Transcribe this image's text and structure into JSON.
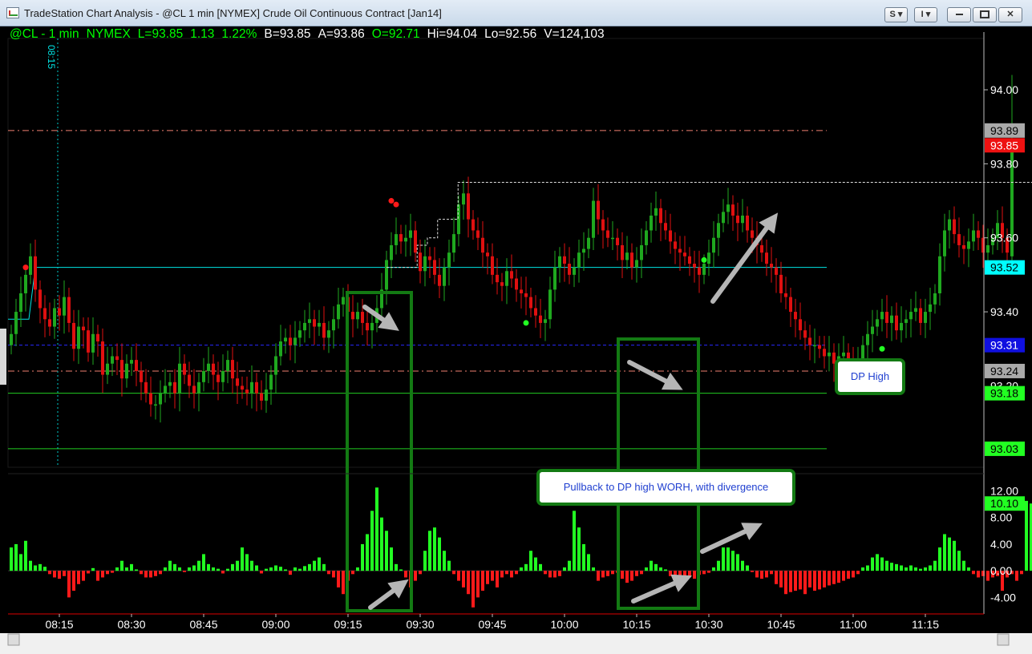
{
  "window": {
    "title": "TradeStation Chart Analysis - @CL 1 min [NYMEX] Crude Oil Continuous Contract [Jan14]",
    "btn_s": "S ▾",
    "btn_i": "I ▾"
  },
  "info": {
    "symbol": "@CL - 1 min",
    "exchange": "NYMEX",
    "last": "L=93.85",
    "change": "1.13",
    "pct": "1.22%",
    "bid": "B=93.85",
    "ask": "A=93.86",
    "open": "O=92.71",
    "high": "Hi=94.04",
    "low": "Lo=92.56",
    "volume": "V=124,103"
  },
  "cursor_time_label": "08:15",
  "callouts": {
    "dp_high": "DP High",
    "pullback": "Pullback to DP high WORH, with divergence"
  },
  "colors": {
    "up": "#1fa81f",
    "down": "#e01010",
    "osc_up": "#22ff22",
    "osc_down": "#ff1a1a",
    "box": "#137a13"
  },
  "chart_data": [
    {
      "type": "candlestick",
      "x_ticks": [
        "08:15",
        "08:30",
        "08:45",
        "09:00",
        "09:15",
        "09:30",
        "09:45",
        "10:00",
        "10:15",
        "10:30",
        "10:45",
        "11:00",
        "11:15"
      ],
      "y_ticks": [
        93.4,
        93.6,
        93.8,
        94.0
      ],
      "y_tick_labels": [
        "93.40",
        "93.60",
        "93.80",
        "94.00"
      ],
      "ylim": [
        92.98,
        94.13
      ],
      "x_start": "08:05",
      "tick_labels_extra": [
        "93.20"
      ],
      "price_tags": [
        {
          "label": "93.89",
          "value": 93.89,
          "bg": "#a9a9a9",
          "fg": "#000"
        },
        {
          "label": "93.85",
          "value": 93.85,
          "bg": "#ee1111",
          "fg": "#fff"
        },
        {
          "label": "93.52",
          "value": 93.52,
          "bg": "#00ffff",
          "fg": "#000"
        },
        {
          "label": "93.31",
          "value": 93.31,
          "bg": "#1010e0",
          "fg": "#fff"
        },
        {
          "label": "93.24",
          "value": 93.24,
          "bg": "#a9a9a9",
          "fg": "#000"
        },
        {
          "label": "93.18",
          "value": 93.18,
          "bg": "#22ff22",
          "fg": "#000"
        },
        {
          "label": "93.03",
          "value": 93.03,
          "bg": "#22ff22",
          "fg": "#000"
        }
      ],
      "levels": [
        {
          "value": 93.89,
          "color": "#f08070",
          "style": "dashdot"
        },
        {
          "value": 93.52,
          "color": "#00e5e5",
          "style": "solid",
          "from": "08:10"
        },
        {
          "value": 93.31,
          "color": "#2828ff",
          "style": "dashed"
        },
        {
          "value": 93.24,
          "color": "#f08070",
          "style": "dashdot"
        },
        {
          "value": 93.18,
          "color": "#22cc22",
          "style": "solid"
        },
        {
          "value": 93.03,
          "color": "#22cc22",
          "style": "solid"
        }
      ],
      "closes": [
        93.34,
        93.4,
        93.45,
        93.5,
        93.55,
        93.46,
        93.41,
        93.38,
        93.36,
        93.41,
        93.39,
        93.44,
        93.37,
        93.3,
        93.36,
        93.35,
        93.29,
        93.34,
        93.32,
        93.23,
        93.26,
        93.28,
        93.27,
        93.22,
        93.26,
        93.27,
        93.24,
        93.21,
        93.18,
        93.15,
        93.15,
        93.18,
        93.2,
        93.21,
        93.18,
        93.26,
        93.23,
        93.2,
        93.18,
        93.21,
        93.24,
        93.26,
        93.23,
        93.21,
        93.24,
        93.27,
        93.22,
        93.2,
        93.19,
        93.18,
        93.21,
        93.18,
        93.16,
        93.19,
        93.23,
        93.28,
        93.32,
        93.33,
        93.31,
        93.33,
        93.35,
        93.37,
        93.38,
        93.36,
        93.37,
        93.33,
        93.35,
        93.38,
        93.42,
        93.44,
        93.4,
        93.38,
        93.4,
        93.37,
        93.35,
        93.37,
        93.41,
        93.46,
        93.54,
        93.58,
        93.61,
        93.59,
        93.6,
        93.62,
        93.56,
        93.51,
        93.55,
        93.54,
        93.5,
        93.47,
        93.52,
        93.56,
        93.61,
        93.69,
        93.72,
        93.65,
        93.62,
        93.6,
        93.56,
        93.55,
        93.5,
        93.48,
        93.47,
        93.51,
        93.49,
        93.46,
        93.45,
        93.44,
        93.41,
        93.39,
        93.37,
        93.38,
        93.46,
        93.52,
        93.55,
        93.53,
        93.5,
        93.52,
        93.56,
        93.57,
        93.6,
        93.7,
        93.65,
        93.62,
        93.6,
        93.6,
        93.58,
        93.54,
        93.56,
        93.52,
        93.54,
        93.58,
        93.62,
        93.66,
        93.68,
        93.64,
        93.62,
        93.59,
        93.57,
        93.56,
        93.55,
        93.53,
        93.52,
        93.5,
        93.53,
        93.56,
        93.6,
        93.64,
        93.67,
        93.69,
        93.66,
        93.64,
        93.66,
        93.62,
        93.6,
        93.58,
        93.56,
        93.53,
        93.52,
        93.5,
        93.45,
        93.44,
        93.4,
        93.38,
        93.35,
        93.33,
        93.31,
        93.31,
        93.3,
        93.28,
        93.29,
        93.26,
        93.28,
        93.29,
        93.27,
        93.25,
        93.26,
        93.31,
        93.34,
        93.36,
        93.38,
        93.4,
        93.37,
        93.39,
        93.35,
        93.37,
        93.38,
        93.4,
        93.41,
        93.37,
        93.4,
        93.42,
        93.45,
        93.55,
        93.62,
        93.65,
        93.61,
        93.58,
        93.57,
        93.59,
        93.62,
        93.6,
        93.56,
        93.58,
        93.6,
        93.64,
        93.6,
        93.56,
        93.85
      ],
      "special_bar": {
        "open": 93.55,
        "high": 94.04,
        "low": 93.53,
        "close": 93.85
      },
      "dashed_step_series": [
        {
          "values": [
            93.52,
            93.52,
            93.52,
            93.58,
            93.6,
            93.65,
            93.65,
            93.75
          ],
          "from_bar": 78,
          "to_bar": 95
        },
        {
          "value": 93.75,
          "from_bar": 95,
          "to_bar": 216
        }
      ],
      "green_dots": [
        {
          "bar": 107,
          "value": 93.37
        },
        {
          "bar": 144,
          "value": 93.54
        },
        {
          "bar": 181,
          "value": 93.3
        }
      ],
      "red_dots": [
        {
          "bar": 3,
          "value": 93.52
        },
        {
          "bar": 79,
          "value": 93.7
        },
        {
          "bar": 80,
          "value": 93.69
        },
        {
          "bar": 216,
          "value": 93.94
        },
        {
          "bar": 217,
          "value": 94.07
        }
      ]
    },
    {
      "type": "bar",
      "name": "oscillator",
      "y_ticks": [
        -4,
        0,
        4,
        8,
        12
      ],
      "y_tick_labels": [
        "-4.00",
        "0.00",
        "4.00",
        "8.00",
        "12.00"
      ],
      "ylim": [
        -6.0,
        13.5
      ],
      "last_value_label": "10.10",
      "values": [
        3.5,
        4.0,
        2.5,
        4.5,
        1.5,
        0.8,
        1.0,
        0.6,
        -0.5,
        -1.0,
        -1.2,
        -0.8,
        -4.0,
        -3.0,
        -2.0,
        -1.5,
        -0.4,
        0.4,
        -1.5,
        -1.0,
        -0.5,
        -0.3,
        0.5,
        1.5,
        0.5,
        1.0,
        0.2,
        -0.5,
        -1.0,
        -1.0,
        -0.8,
        -0.5,
        0.5,
        1.5,
        1.0,
        0.5,
        -0.2,
        0.5,
        0.8,
        1.5,
        2.5,
        1.0,
        0.5,
        0.3,
        -0.4,
        0.3,
        1.0,
        1.5,
        3.5,
        2.5,
        1.5,
        0.8,
        -0.4,
        0.3,
        0.5,
        0.8,
        0.6,
        0.2,
        -0.6,
        0.5,
        0.3,
        0.7,
        1.0,
        1.5,
        2.0,
        1.0,
        -0.5,
        -1.0,
        -2.5,
        -3.5,
        -1.5,
        -0.5,
        0.5,
        4.0,
        5.5,
        9.0,
        12.5,
        8.0,
        6.0,
        3.5,
        1.0,
        0.2,
        -1.0,
        -2.5,
        -1.5,
        -0.5,
        3.0,
        6.0,
        6.5,
        5.0,
        3.0,
        1.5,
        -0.5,
        -1.5,
        -2.5,
        -3.5,
        -5.5,
        -4.0,
        -3.0,
        -2.0,
        -1.5,
        -2.5,
        -1.0,
        -0.5,
        -1.0,
        -0.5,
        0.5,
        1.0,
        3.0,
        2.0,
        1.0,
        -0.5,
        -1.0,
        -1.0,
        -0.8,
        0.5,
        1.5,
        9.0,
        6.5,
        4.0,
        2.5,
        0.5,
        -1.5,
        -1.0,
        -0.8,
        -0.5,
        -0.3,
        -1.2,
        -1.8,
        -1.5,
        -0.8,
        -0.5,
        0.5,
        1.5,
        1.0,
        0.5,
        0.2,
        -0.8,
        -1.0,
        -1.2,
        -1.5,
        -1.0,
        -1.2,
        -0.6,
        -0.5,
        -0.3,
        0.5,
        1.5,
        3.5,
        3.5,
        3.0,
        2.5,
        1.5,
        0.8,
        -0.2,
        -1.0,
        -1.2,
        -1.0,
        -0.5,
        -2.0,
        -2.5,
        -3.5,
        -3.2,
        -3.0,
        -2.8,
        -3.5,
        -2.5,
        -3.0,
        -2.8,
        -2.5,
        -2.2,
        -2.0,
        -1.8,
        -1.5,
        -1.2,
        -1.0,
        -0.5,
        0.5,
        0.8,
        2.0,
        2.5,
        2.0,
        1.5,
        1.2,
        1.0,
        0.8,
        0.5,
        0.8,
        0.5,
        0.3,
        0.5,
        0.8,
        1.5,
        3.5,
        5.5,
        5.0,
        4.5,
        3.0,
        1.5,
        0.5,
        -0.5,
        -1.0,
        -0.8,
        -1.5,
        -1.0,
        -0.8,
        -3.0,
        -1.0,
        -0.5,
        -1.5,
        -0.5,
        10.5,
        10.1
      ]
    }
  ]
}
